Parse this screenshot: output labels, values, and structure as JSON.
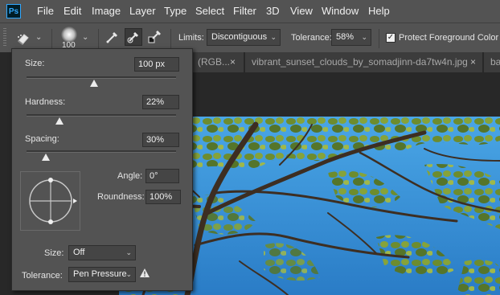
{
  "app": {
    "logo_text": "Ps"
  },
  "menu": [
    "File",
    "Edit",
    "Image",
    "Layer",
    "Type",
    "Select",
    "Filter",
    "3D",
    "View",
    "Window",
    "Help"
  ],
  "options_bar": {
    "tool_icon": "background-eraser-icon",
    "brush_size_value": "100",
    "sampling_icons": [
      "sampling-continuous-icon",
      "sampling-once-icon",
      "sampling-background-swatch-icon"
    ],
    "limits_label": "Limits:",
    "limits_value": "Discontiguous",
    "tolerance_label": "Tolerance:",
    "tolerance_value": "58%",
    "protect_foreground_label": "Protect Foreground Color",
    "protect_foreground_checked": true
  },
  "tabs": [
    {
      "label": "(RGB...",
      "close": "×"
    },
    {
      "label": "vibrant_sunset_clouds_by_somadjinn-da7tw4n.jpg",
      "close": "×"
    },
    {
      "label": "ba",
      "close": ""
    }
  ],
  "brush_popup": {
    "size_label": "Size:",
    "size_value": "100 px",
    "size_fraction": 0.45,
    "hardness_label": "Hardness:",
    "hardness_value": "22%",
    "hardness_fraction": 0.22,
    "spacing_label": "Spacing:",
    "spacing_value": "30%",
    "spacing_fraction": 0.13,
    "angle_label": "Angle:",
    "angle_value": "0°",
    "roundness_label": "Roundness:",
    "roundness_value": "100%",
    "pen_size_label": "Size:",
    "pen_size_value": "Off",
    "pen_tolerance_label": "Tolerance:",
    "pen_tolerance_value": "Pen Pressure",
    "warning_icon": "warning-icon"
  },
  "colors": {
    "panel": "#535353",
    "background": "#282828",
    "sky": "#2f8fd8",
    "leaf": "#6f8f2f",
    "ps_blue": "#31a8ff"
  }
}
